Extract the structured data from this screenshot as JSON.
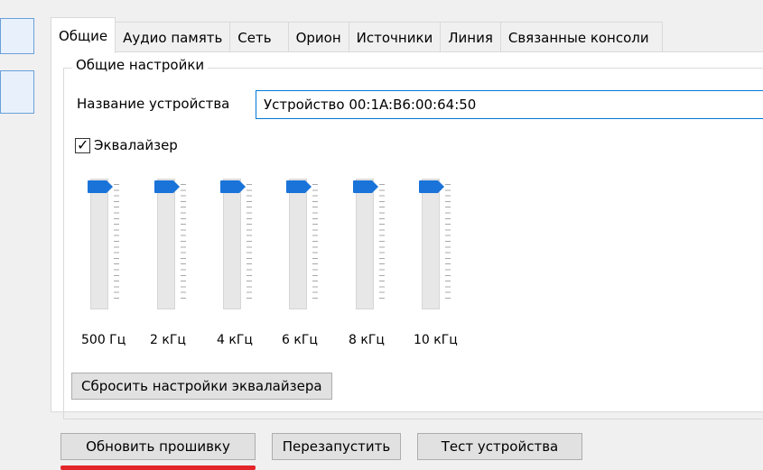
{
  "tabs": [
    {
      "label": "Общие",
      "active": true
    },
    {
      "label": "Аудио память",
      "active": false
    },
    {
      "label": "Сеть",
      "active": false
    },
    {
      "label": "Орион",
      "active": false
    },
    {
      "label": "Источники",
      "active": false
    },
    {
      "label": "Линия",
      "active": false
    },
    {
      "label": "Связанные консоли",
      "active": false
    }
  ],
  "general": {
    "group_title": "Общие настройки",
    "device_name_label": "Название устройства",
    "device_name_value": "Устройство 00:1A:B6:00:64:50",
    "equalizer_label": "Эквалайзер",
    "equalizer_checked": true
  },
  "equalizer": {
    "bands": [
      {
        "label": "500 Гц",
        "level": 1.0
      },
      {
        "label": "2 кГц",
        "level": 1.0
      },
      {
        "label": "4 кГц",
        "level": 1.0
      },
      {
        "label": "6 кГц",
        "level": 1.0
      },
      {
        "label": "8 кГц",
        "level": 1.0
      },
      {
        "label": "10 кГц",
        "level": 1.0
      }
    ],
    "reset_label": "Сбросить настройки эквалайзера"
  },
  "actions": {
    "update_firmware": "Обновить прошивку",
    "restart": "Перезапустить",
    "test_device": "Тест устройства"
  },
  "colors": {
    "thumb": "#1a73d9",
    "highlight": "#e3262a",
    "focus_border": "#0078d7"
  }
}
